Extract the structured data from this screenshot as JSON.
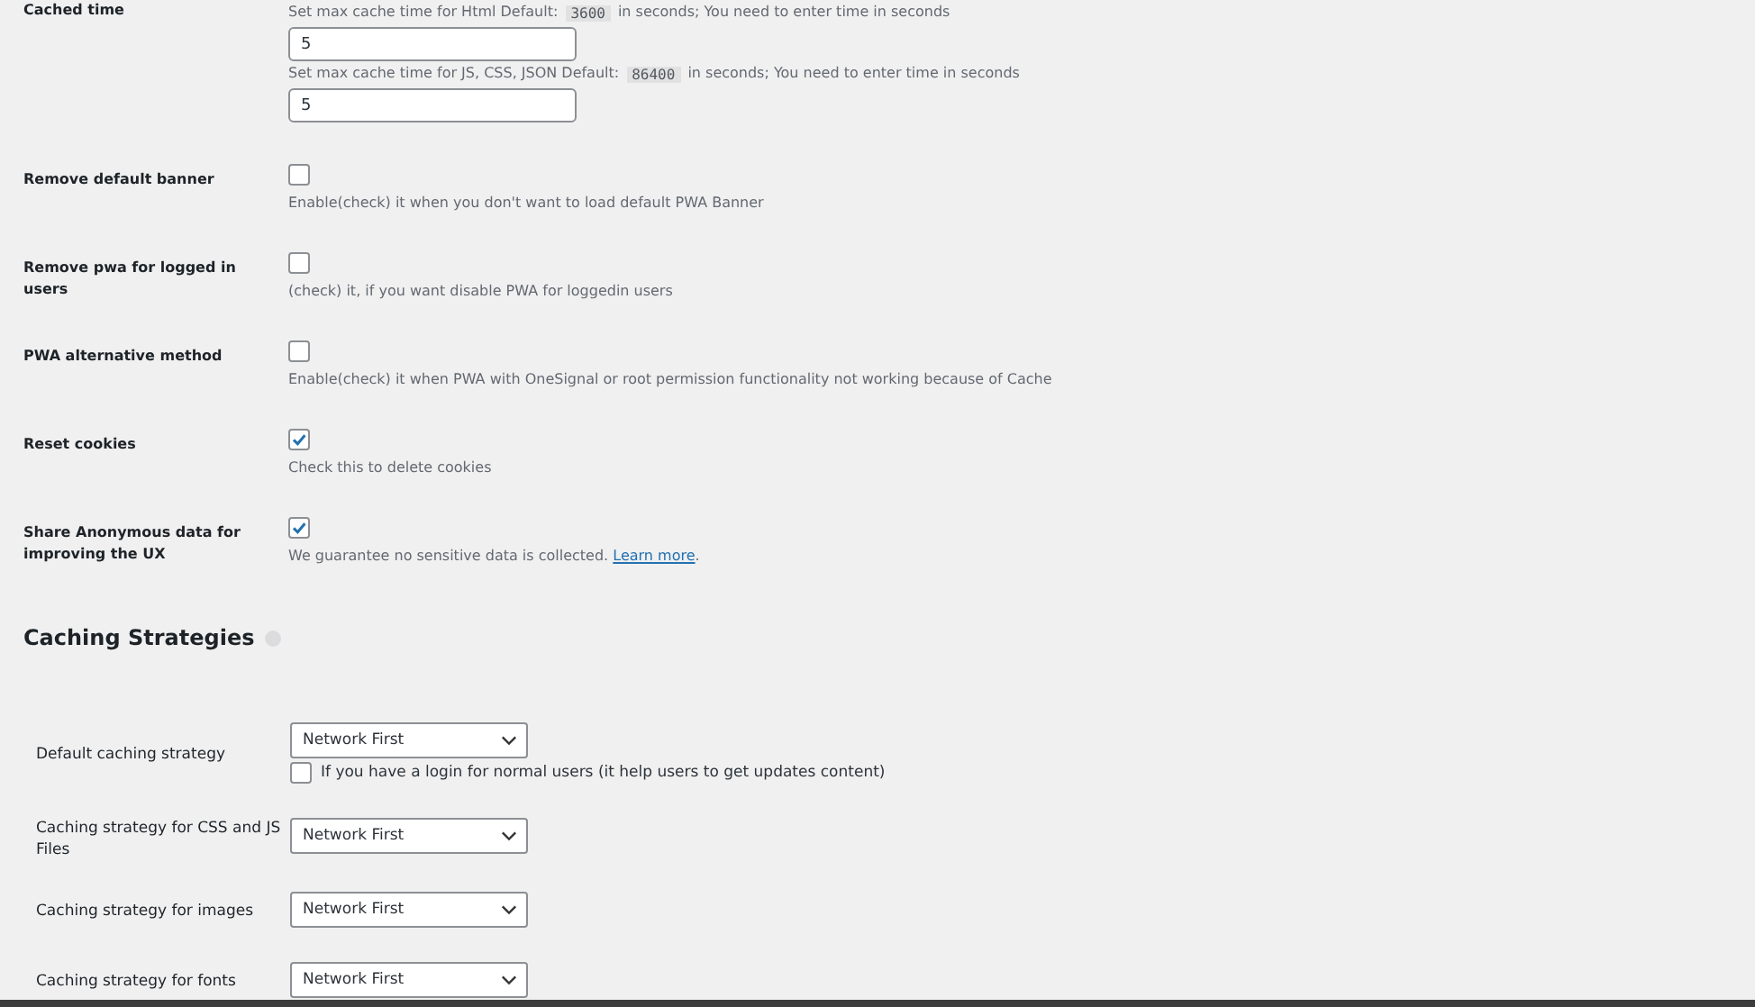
{
  "cache_time": {
    "label": "Cached time",
    "fields": [
      {
        "help": "Set max cache time for Html Default:",
        "code": "3600",
        "help_after": "in seconds; You need to enter time in seconds",
        "value": "5"
      },
      {
        "help": "Set max cache time for JS, CSS, JSON Default:",
        "code": "86400",
        "help_after": "in seconds; You need to enter time in seconds",
        "value": "5"
      }
    ]
  },
  "settings": [
    {
      "label": "Remove default banner",
      "checked": false,
      "help": "Enable(check) it when you don't want to load default PWA Banner"
    },
    {
      "label": "Remove pwa for logged in users",
      "checked": false,
      "help": "(check) it, if you want disable PWA for loggedin users"
    },
    {
      "label": "PWA alternative method",
      "checked": false,
      "help": "Enable(check) it when PWA with OneSignal or root permission functionality not working because of Cache"
    },
    {
      "label": "Reset cookies",
      "checked": true,
      "help": "Check this to delete cookies"
    },
    {
      "label": "Share Anonymous data for improving the UX",
      "checked": true,
      "help": "We guarantee no sensitive data is collected.",
      "link": "Learn more",
      "help_after": "."
    }
  ],
  "caching_strategies": {
    "title": "Caching Strategies",
    "rows": [
      {
        "label": "Default caching strategy",
        "value": "Network First",
        "option": {
          "label": "If you have a login for normal users (it help users to get updates content)",
          "checked": false
        }
      },
      {
        "label": "Caching strategy for CSS and JS Files",
        "value": "Network First"
      },
      {
        "label": "Caching strategy for images",
        "value": "Network First"
      },
      {
        "label": "Caching strategy for fonts",
        "value": "Network First"
      }
    ]
  }
}
